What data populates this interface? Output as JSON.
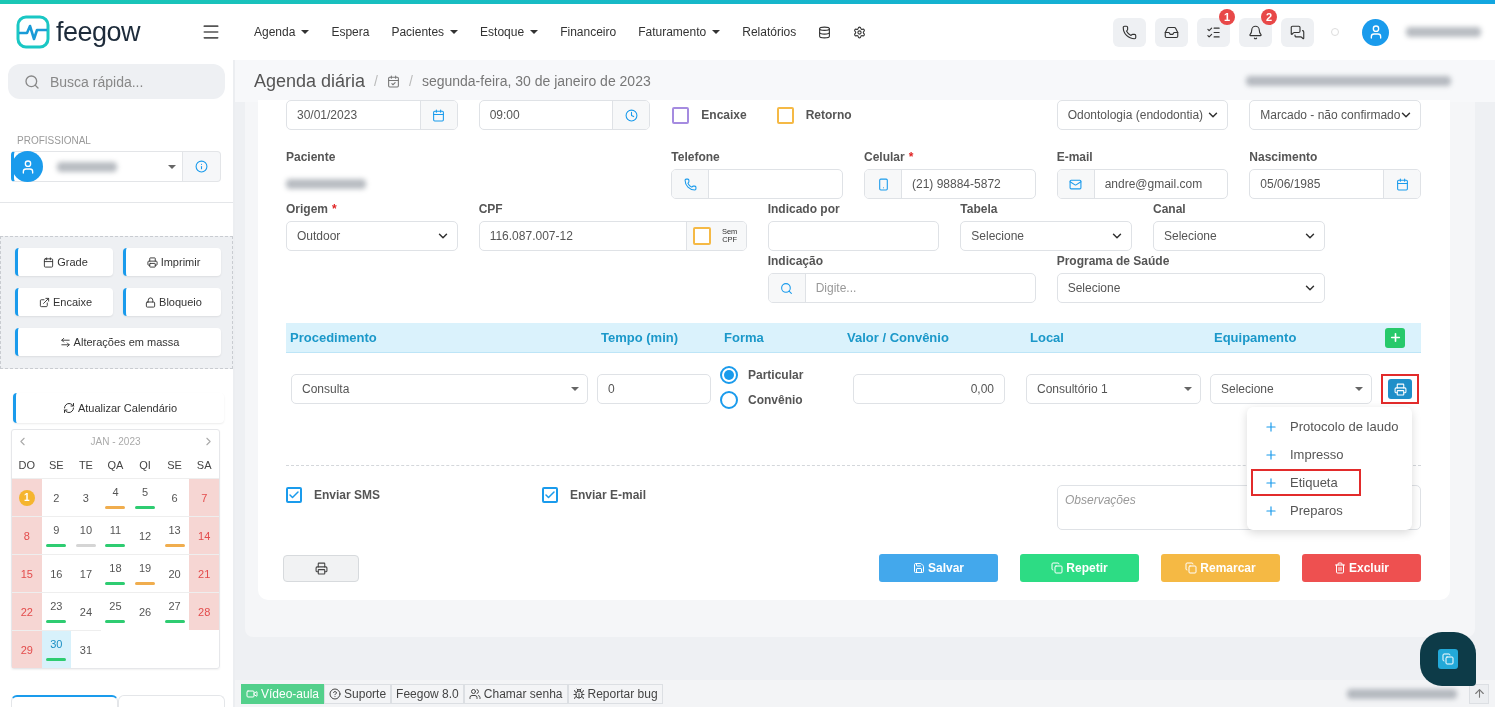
{
  "logo": "feegow",
  "nav": [
    {
      "label": "Agenda",
      "dropdown": true
    },
    {
      "label": "Espera",
      "dropdown": false
    },
    {
      "label": "Pacientes",
      "dropdown": true
    },
    {
      "label": "Estoque",
      "dropdown": true
    },
    {
      "label": "Financeiro",
      "dropdown": false
    },
    {
      "label": "Faturamento",
      "dropdown": true
    },
    {
      "label": "Relatórios",
      "dropdown": false
    }
  ],
  "nav_icons": [
    {
      "kind": "database"
    },
    {
      "kind": "settings"
    }
  ],
  "toolbar": [
    {
      "kind": "phone"
    },
    {
      "kind": "inbox"
    },
    {
      "kind": "tasks",
      "badge": "1"
    },
    {
      "kind": "bell",
      "badge": "2"
    },
    {
      "kind": "chat"
    }
  ],
  "sidebar": {
    "search_placeholder": "Busca rápida...",
    "section_label": "PROFISSIONAL",
    "actions": [
      {
        "label": "Grade",
        "kind": "calendar"
      },
      {
        "label": "Imprimir",
        "kind": "printer"
      },
      {
        "label": "Encaixe",
        "kind": "external"
      },
      {
        "label": "Bloqueio",
        "kind": "lock"
      },
      {
        "label": "Alterações em massa",
        "kind": "swap"
      }
    ],
    "refresh_label": "Atualizar Calendário",
    "calendar": {
      "title": "JAN - 2023",
      "weekdays": [
        "DO",
        "SE",
        "TE",
        "QA",
        "QI",
        "SE",
        "SA"
      ],
      "days": [
        {
          "day": "1",
          "kind": "holiday",
          "selected": false
        },
        {
          "day": "2",
          "kind": "weekday",
          "selected": false
        },
        {
          "day": "3",
          "kind": "weekday",
          "selected": false
        },
        {
          "day": "4",
          "kind": "weekday",
          "selected": false,
          "color": "#f0ad4e"
        },
        {
          "day": "5",
          "kind": "weekday",
          "selected": false,
          "color": "#2ecc71"
        },
        {
          "day": "6",
          "kind": "weekday",
          "selected": false
        },
        {
          "day": "7",
          "kind": "weekend",
          "selected": false
        },
        {
          "day": "8",
          "kind": "weekend",
          "selected": false
        },
        {
          "day": "9",
          "kind": "weekday",
          "selected": false,
          "color": "#2ecc71"
        },
        {
          "day": "10",
          "kind": "weekday",
          "selected": false,
          "color": "#d5d5d5"
        },
        {
          "day": "11",
          "kind": "weekday",
          "selected": false,
          "color": "#2ecc71"
        },
        {
          "day": "12",
          "kind": "weekday",
          "selected": false
        },
        {
          "day": "13",
          "kind": "weekday",
          "selected": false,
          "color": "#f0ad4e"
        },
        {
          "day": "14",
          "kind": "weekend",
          "selected": false
        },
        {
          "day": "15",
          "kind": "weekend",
          "selected": false
        },
        {
          "day": "16",
          "kind": "weekday",
          "selected": false
        },
        {
          "day": "17",
          "kind": "weekday",
          "selected": false
        },
        {
          "day": "18",
          "kind": "weekday",
          "selected": false,
          "color": "#2ecc71"
        },
        {
          "day": "19",
          "kind": "weekday",
          "selected": false,
          "color": "#f0ad4e"
        },
        {
          "day": "20",
          "kind": "weekday",
          "selected": false
        },
        {
          "day": "21",
          "kind": "weekend",
          "selected": false
        },
        {
          "day": "22",
          "kind": "weekend",
          "selected": false
        },
        {
          "day": "23",
          "kind": "weekday",
          "selected": false,
          "color": "#2ecc71"
        },
        {
          "day": "24",
          "kind": "weekday",
          "selected": false
        },
        {
          "day": "25",
          "kind": "weekday",
          "selected": false,
          "color": "#2ecc71"
        },
        {
          "day": "26",
          "kind": "weekday",
          "selected": false
        },
        {
          "day": "27",
          "kind": "weekday",
          "selected": false,
          "color": "#2ecc71"
        },
        {
          "day": "28",
          "kind": "weekend",
          "selected": false
        },
        {
          "day": "29",
          "kind": "weekend",
          "selected": false
        },
        {
          "day": "30",
          "kind": "weekday",
          "selected": true,
          "color": "#2ecc71"
        },
        {
          "day": "31",
          "kind": "weekday",
          "selected": false
        }
      ]
    },
    "tabs": [
      {
        "selected": true
      },
      {
        "selected": false
      }
    ]
  },
  "breadcrumb": {
    "title": "Agenda diária",
    "separators": [
      "/",
      "/"
    ],
    "date": "segunda-feira, 30 de janeiro de 2023"
  },
  "form": {
    "rows": [
      {
        "fields": [
          {
            "kind": "date",
            "value": "30/01/2023"
          },
          {
            "kind": "time",
            "value": "09:00"
          },
          {
            "kind": "checks",
            "items": [
              {
                "label": "Encaixe",
                "checked": false,
                "color": "#a58be0"
              },
              {
                "label": "Retorno",
                "checked": false,
                "color": "#f5b945"
              }
            ]
          },
          {
            "kind": "select",
            "value": "Odontologia (endodontia)"
          },
          {
            "kind": "select",
            "value": "Marcado - não confirmado"
          }
        ]
      },
      {
        "fields": [
          {
            "kind": "patient",
            "label": "Paciente"
          },
          {
            "kind": "phone",
            "label": "Telefone"
          },
          {
            "kind": "mobile",
            "label": "Celular",
            "required_mark": "*",
            "value": "(21) 98884-5872"
          },
          {
            "kind": "email",
            "label": "E-mail",
            "value": "andre@gmail.com"
          },
          {
            "kind": "date",
            "label": "Nascimento",
            "value": "05/06/1985"
          }
        ]
      },
      {
        "fields": [
          {
            "kind": "select",
            "label": "Origem",
            "required_mark": "*",
            "value": "Outdoor"
          },
          {
            "kind": "cpf",
            "label": "CPF",
            "value": "116.087.007-12",
            "toggle_label": "Sem CPF",
            "checked": false
          },
          {
            "kind": "text",
            "label": "Indicado por"
          },
          {
            "kind": "select",
            "label": "Tabela",
            "value": "Selecione"
          },
          {
            "kind": "select",
            "label": "Canal",
            "value": "Selecione"
          }
        ]
      },
      {
        "fields": [
          {
            "kind": "search",
            "label": "Indicação",
            "placeholder": "Digite..."
          },
          {
            "kind": "select",
            "label": "Programa de Saúde",
            "value": "Selecione"
          }
        ]
      }
    ]
  },
  "procedures": {
    "columns": [
      "Procedimento",
      "Tempo (min)",
      "Forma",
      "Valor / Convênio",
      "Local",
      "Equipamento"
    ],
    "row": {
      "procedure": "Consulta",
      "time": "0",
      "payment": [
        {
          "label": "Particular",
          "selected": true
        },
        {
          "label": "Convênio",
          "selected": false
        }
      ],
      "value": "0,00",
      "place": "Consultório 1",
      "equipment": "Selecione",
      "print_highlighted": true
    }
  },
  "print_menu": [
    {
      "label": "Protocolo de laudo",
      "highlighted": false
    },
    {
      "label": "Impresso",
      "highlighted": false
    },
    {
      "label": "Etiqueta",
      "highlighted": true
    },
    {
      "label": "Preparos",
      "highlighted": false
    }
  ],
  "notifications": [
    {
      "label": "Enviar SMS",
      "checked": true
    },
    {
      "label": "Enviar E-mail",
      "checked": true
    }
  ],
  "notes_placeholder": "Observações",
  "actions": [
    {
      "label": "Salvar",
      "kind": "save"
    },
    {
      "label": "Repetir",
      "kind": "repeat"
    },
    {
      "label": "Remarcar",
      "kind": "reschedule"
    },
    {
      "label": "Excluir",
      "kind": "delete"
    }
  ],
  "footer": [
    {
      "label": "Vídeo-aula",
      "kind": "video"
    },
    {
      "label": "Suporte",
      "kind": "help"
    },
    {
      "label": "Feegow 8.0",
      "kind": "version"
    },
    {
      "label": "Chamar senha",
      "kind": "users"
    },
    {
      "label": "Reportar bug",
      "kind": "bug"
    }
  ]
}
